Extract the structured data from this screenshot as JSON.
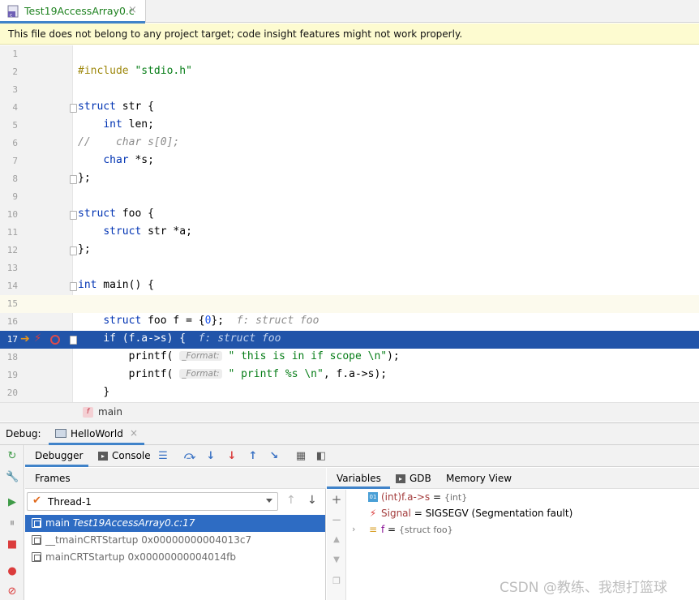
{
  "editor_tab": {
    "filename": "Test19AccessArray0.c",
    "close_glyph": "×"
  },
  "banner": {
    "message": "This file does not belong to any project target; code insight features might not work properly."
  },
  "code": {
    "lines": [
      {
        "n": "1"
      },
      {
        "n": "2"
      },
      {
        "n": "3"
      },
      {
        "n": "4"
      },
      {
        "n": "5"
      },
      {
        "n": "6"
      },
      {
        "n": "7"
      },
      {
        "n": "8"
      },
      {
        "n": "9"
      },
      {
        "n": "10"
      },
      {
        "n": "11"
      },
      {
        "n": "12"
      },
      {
        "n": "13"
      },
      {
        "n": "14"
      },
      {
        "n": "15"
      },
      {
        "n": "16"
      },
      {
        "n": "17"
      },
      {
        "n": "18"
      },
      {
        "n": "19"
      },
      {
        "n": "20"
      }
    ],
    "tokens": {
      "include_kw": "#include",
      "include_str": "\"stdio.h\"",
      "struct": "struct",
      "str_name": " str {",
      "int": "int",
      "len": " len;",
      "comment": "//    char s[0];",
      "char": "char",
      "star_s": " *s;",
      "close_semi": "};",
      "foo_name": " foo {",
      "struct_str_a_mid": " str *a;",
      "int_main": "int",
      "main_sig": " main() {",
      "decl_mid": " foo f = {",
      "zero": "0",
      "decl_end": "};",
      "hint_f": "f: struct foo",
      "if_stmt": "if (f.a->s) {",
      "printf_open": "printf(",
      "param_format": "_Format:",
      "printf1_str": "\" this is in if scope \\n\"",
      "printf1_end": ");",
      "printf2_str": "\" printf %s \\n\"",
      "printf2_end": ", f.a->s);",
      "close_brace": "}"
    },
    "current_line": "15",
    "execution_line": "17"
  },
  "breadcrumb": {
    "icon_letter": "f",
    "function": "main"
  },
  "debug": {
    "title": "Debug:",
    "session_name": "HelloWorld",
    "session_close": "×"
  },
  "toolbar": {
    "debugger_tab": "Debugger",
    "console_tab": "Console"
  },
  "frames": {
    "title": "Frames",
    "thread": "Thread-1",
    "rows": [
      {
        "func": "main",
        "location": "Test19AccessArray0.c:17"
      },
      {
        "func": "__tmainCRTStartup",
        "location": "0x00000000004013c7"
      },
      {
        "func": "mainCRTStartup",
        "location": "0x00000000004014fb"
      }
    ]
  },
  "variables_tabs": {
    "variables": "Variables",
    "gdb": "GDB",
    "memory": "Memory View"
  },
  "variables": {
    "watch": {
      "name": "(int)f.a->s",
      "eq": " = ",
      "type": "{int}"
    },
    "signal": {
      "name": "Signal",
      "eq": " = ",
      "value": "SIGSEGV (Segmentation fault)"
    },
    "f": {
      "name": "f",
      "eq": " = ",
      "type": "{struct foo}"
    }
  },
  "watermark": "CSDN @教练、我想打篮球",
  "colors": {
    "execution_highlight": "#2154a9",
    "selected_frame": "#2e6cc3",
    "tab_accent": "#4083c9",
    "banner_bg": "#fdfbd0"
  }
}
